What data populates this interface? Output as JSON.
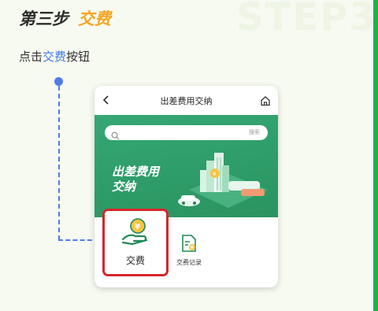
{
  "header": {
    "step_label": "第三步",
    "step_action": "交费",
    "watermark": "STEP3"
  },
  "instruction": {
    "prefix": "点击",
    "highlight": "交费",
    "suffix": "按钮"
  },
  "phone": {
    "nav": {
      "back_icon": "chevron-left-icon",
      "title": "出差费用交纳",
      "home_icon": "home-icon"
    },
    "search": {
      "placeholder": "",
      "button_label": "搜索"
    },
    "banner": {
      "title_line1": "出差费用",
      "title_line2": "交纳"
    },
    "menu": {
      "pay_label": "交费",
      "records_label": "交费记录"
    }
  },
  "colors": {
    "accent_orange": "#f6a623",
    "highlight_blue": "#3f78e4",
    "brand_green": "#2a9460",
    "highlight_red": "#d6262b",
    "right_border_green": "#22b04a"
  }
}
